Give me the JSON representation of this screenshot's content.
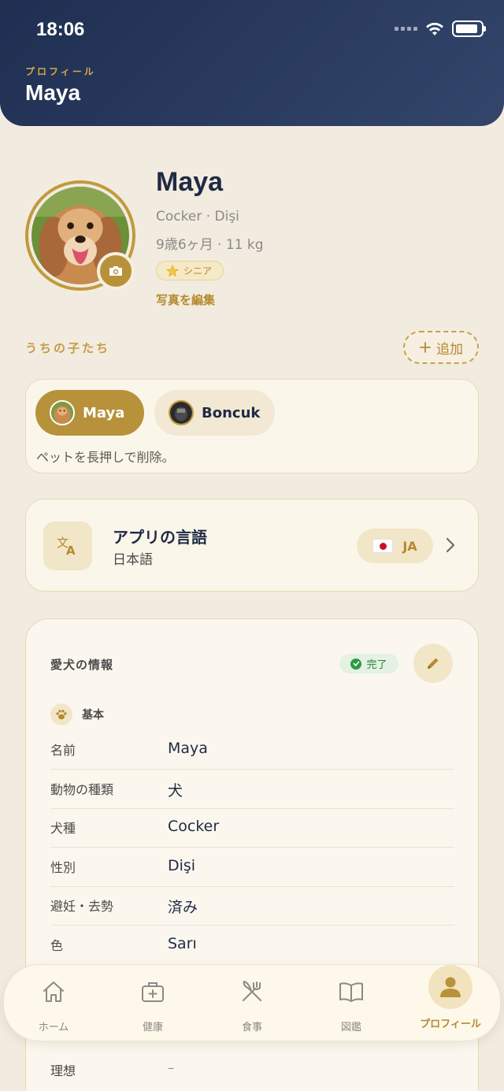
{
  "status_bar": {
    "time": "18:06"
  },
  "header": {
    "kicker": "プロフィール",
    "title": "Maya"
  },
  "profile": {
    "name": "Maya",
    "breed_line": "Cocker · Dişi",
    "age_line": "9歳6ヶ月 · 11 kg",
    "badge": "シニア",
    "edit_photo": "写真を編集"
  },
  "pets_section": {
    "label": "うちの子たち",
    "add_label": "追加",
    "pets": [
      {
        "name": "Maya",
        "active": true
      },
      {
        "name": "Boncuk",
        "active": false
      }
    ],
    "hint": "ペットを長押しで削除。"
  },
  "language": {
    "title": "アプリの言語",
    "current": "日本語",
    "code": "JA"
  },
  "info": {
    "title": "愛犬の情報",
    "status": "完了",
    "group": "基本",
    "fields": [
      {
        "label": "名前",
        "value": "Maya"
      },
      {
        "label": "動物の種類",
        "value": "犬"
      },
      {
        "label": "犬種",
        "value": "Cocker"
      },
      {
        "label": "性別",
        "value": "Dişi"
      },
      {
        "label": "避妊・去勢",
        "value": "済み"
      },
      {
        "label": "色",
        "value": "Sarı"
      }
    ],
    "ideal": {
      "label": "理想",
      "value": "–"
    }
  },
  "tabbar": {
    "tabs": [
      {
        "label": "ホーム",
        "icon": "home-icon"
      },
      {
        "label": "健康",
        "icon": "medical-kit-icon"
      },
      {
        "label": "食事",
        "icon": "utensils-icon"
      },
      {
        "label": "図鑑",
        "icon": "book-icon"
      },
      {
        "label": "プロフィール",
        "icon": "person-icon",
        "active": true
      }
    ]
  },
  "colors": {
    "accent": "#b8923a",
    "header": "#1f2f52",
    "background": "#f2ebdf"
  }
}
